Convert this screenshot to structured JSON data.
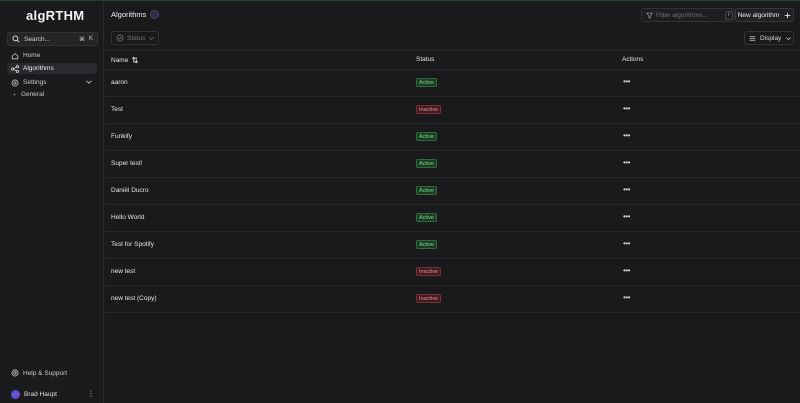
{
  "app": {
    "logo": "algRTHM"
  },
  "sidebar": {
    "search_label": "Search...",
    "search_shortcut_mod": "⌘",
    "search_shortcut_key": "K",
    "items": [
      {
        "label": "Home",
        "icon": "home-icon"
      },
      {
        "label": "Algorithms",
        "icon": "algorithms-icon",
        "active": true
      },
      {
        "label": "Settings",
        "icon": "settings-icon"
      }
    ],
    "settings_sub": [
      {
        "label": "General"
      }
    ],
    "help_label": "Help & Support",
    "user_name": "Brad Haupt"
  },
  "header": {
    "title": "Algorithms",
    "filter_placeholder": "Filter algorithms...",
    "filter_shortcut": "/",
    "new_button": "New algorithm"
  },
  "toolbar": {
    "status_filter": "Status",
    "display_button": "Display"
  },
  "table": {
    "columns": [
      "Name",
      "Status",
      "Actions"
    ],
    "rows": [
      {
        "name": "aaron",
        "status": "Active"
      },
      {
        "name": "Test",
        "status": "Inactive"
      },
      {
        "name": "Funkify",
        "status": "Active"
      },
      {
        "name": "Super test!",
        "status": "Active"
      },
      {
        "name": "Daniël Ducro",
        "status": "Active"
      },
      {
        "name": "Hello World",
        "status": "Active"
      },
      {
        "name": "Test for Spotify",
        "status": "Active"
      },
      {
        "name": "new test",
        "status": "Inactive"
      },
      {
        "name": "new test (Copy)",
        "status": "Inactive"
      }
    ],
    "actions_glyph": "•••"
  },
  "colors": {
    "background": "#1a1a1c",
    "active_badge": "#7bd88f",
    "inactive_badge": "#f08a8f"
  }
}
